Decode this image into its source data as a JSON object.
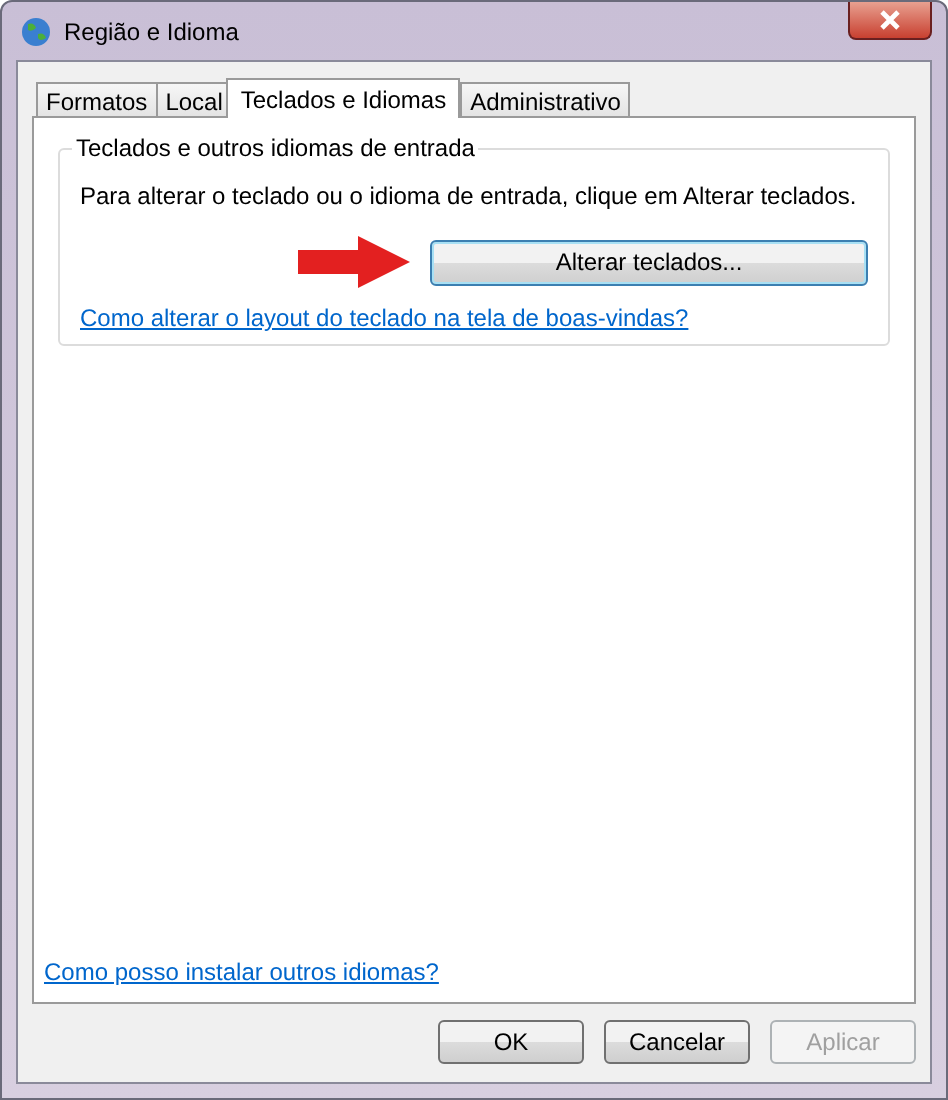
{
  "window": {
    "title": "Região e Idioma"
  },
  "tabs": [
    {
      "label": "Formatos",
      "selected": false
    },
    {
      "label": "Local",
      "selected": false
    },
    {
      "label": "Teclados e Idiomas",
      "selected": true
    },
    {
      "label": "Administrativo",
      "selected": false
    }
  ],
  "group": {
    "title": "Teclados e outros idiomas de entrada",
    "text": "Para alterar o teclado ou o idioma de entrada, clique em Alterar teclados.",
    "button": "Alterar teclados...",
    "link": "Como alterar o layout do teclado na tela de boas-vindas?"
  },
  "bottom_link": "Como posso instalar outros idiomas?",
  "buttons": [
    {
      "label": "OK",
      "disabled": false
    },
    {
      "label": "Cancelar",
      "disabled": false
    },
    {
      "label": "Aplicar",
      "disabled": true
    }
  ]
}
